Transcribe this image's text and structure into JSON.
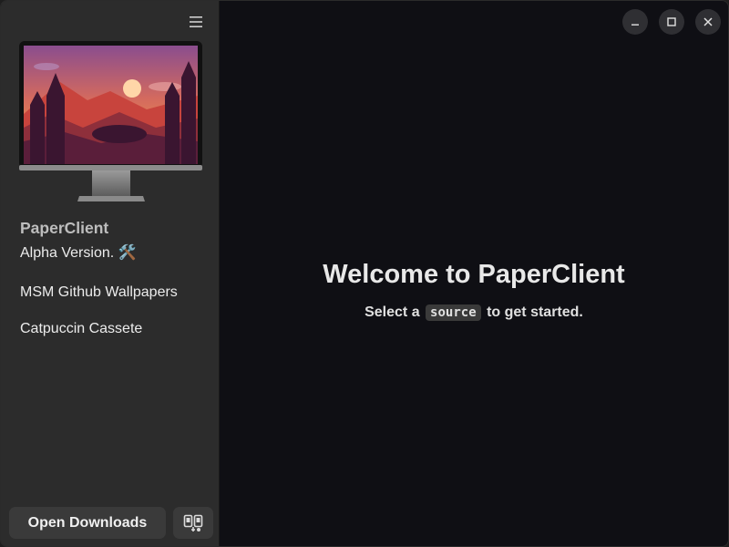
{
  "sidebar": {
    "menu_icon": "hamburger-menu-icon",
    "app_title": "PaperClient",
    "app_subtitle": "Alpha Version. 🛠️",
    "sources": [
      {
        "label": "MSM Github Wallpapers"
      },
      {
        "label": "Catpuccin Cassete"
      }
    ],
    "open_downloads_label": "Open Downloads",
    "compare_icon": "compare-icon"
  },
  "window_controls": {
    "minimize_icon": "minimize-icon",
    "maximize_icon": "maximize-icon",
    "close_icon": "close-icon"
  },
  "main": {
    "welcome_title": "Welcome to PaperClient",
    "welcome_prefix": "Select a",
    "welcome_code": "source",
    "welcome_suffix": "to get started."
  },
  "colors": {
    "sidebar_bg": "#2c2c2c",
    "main_bg": "#0f0f14",
    "button_bg": "#3a3a3a"
  }
}
